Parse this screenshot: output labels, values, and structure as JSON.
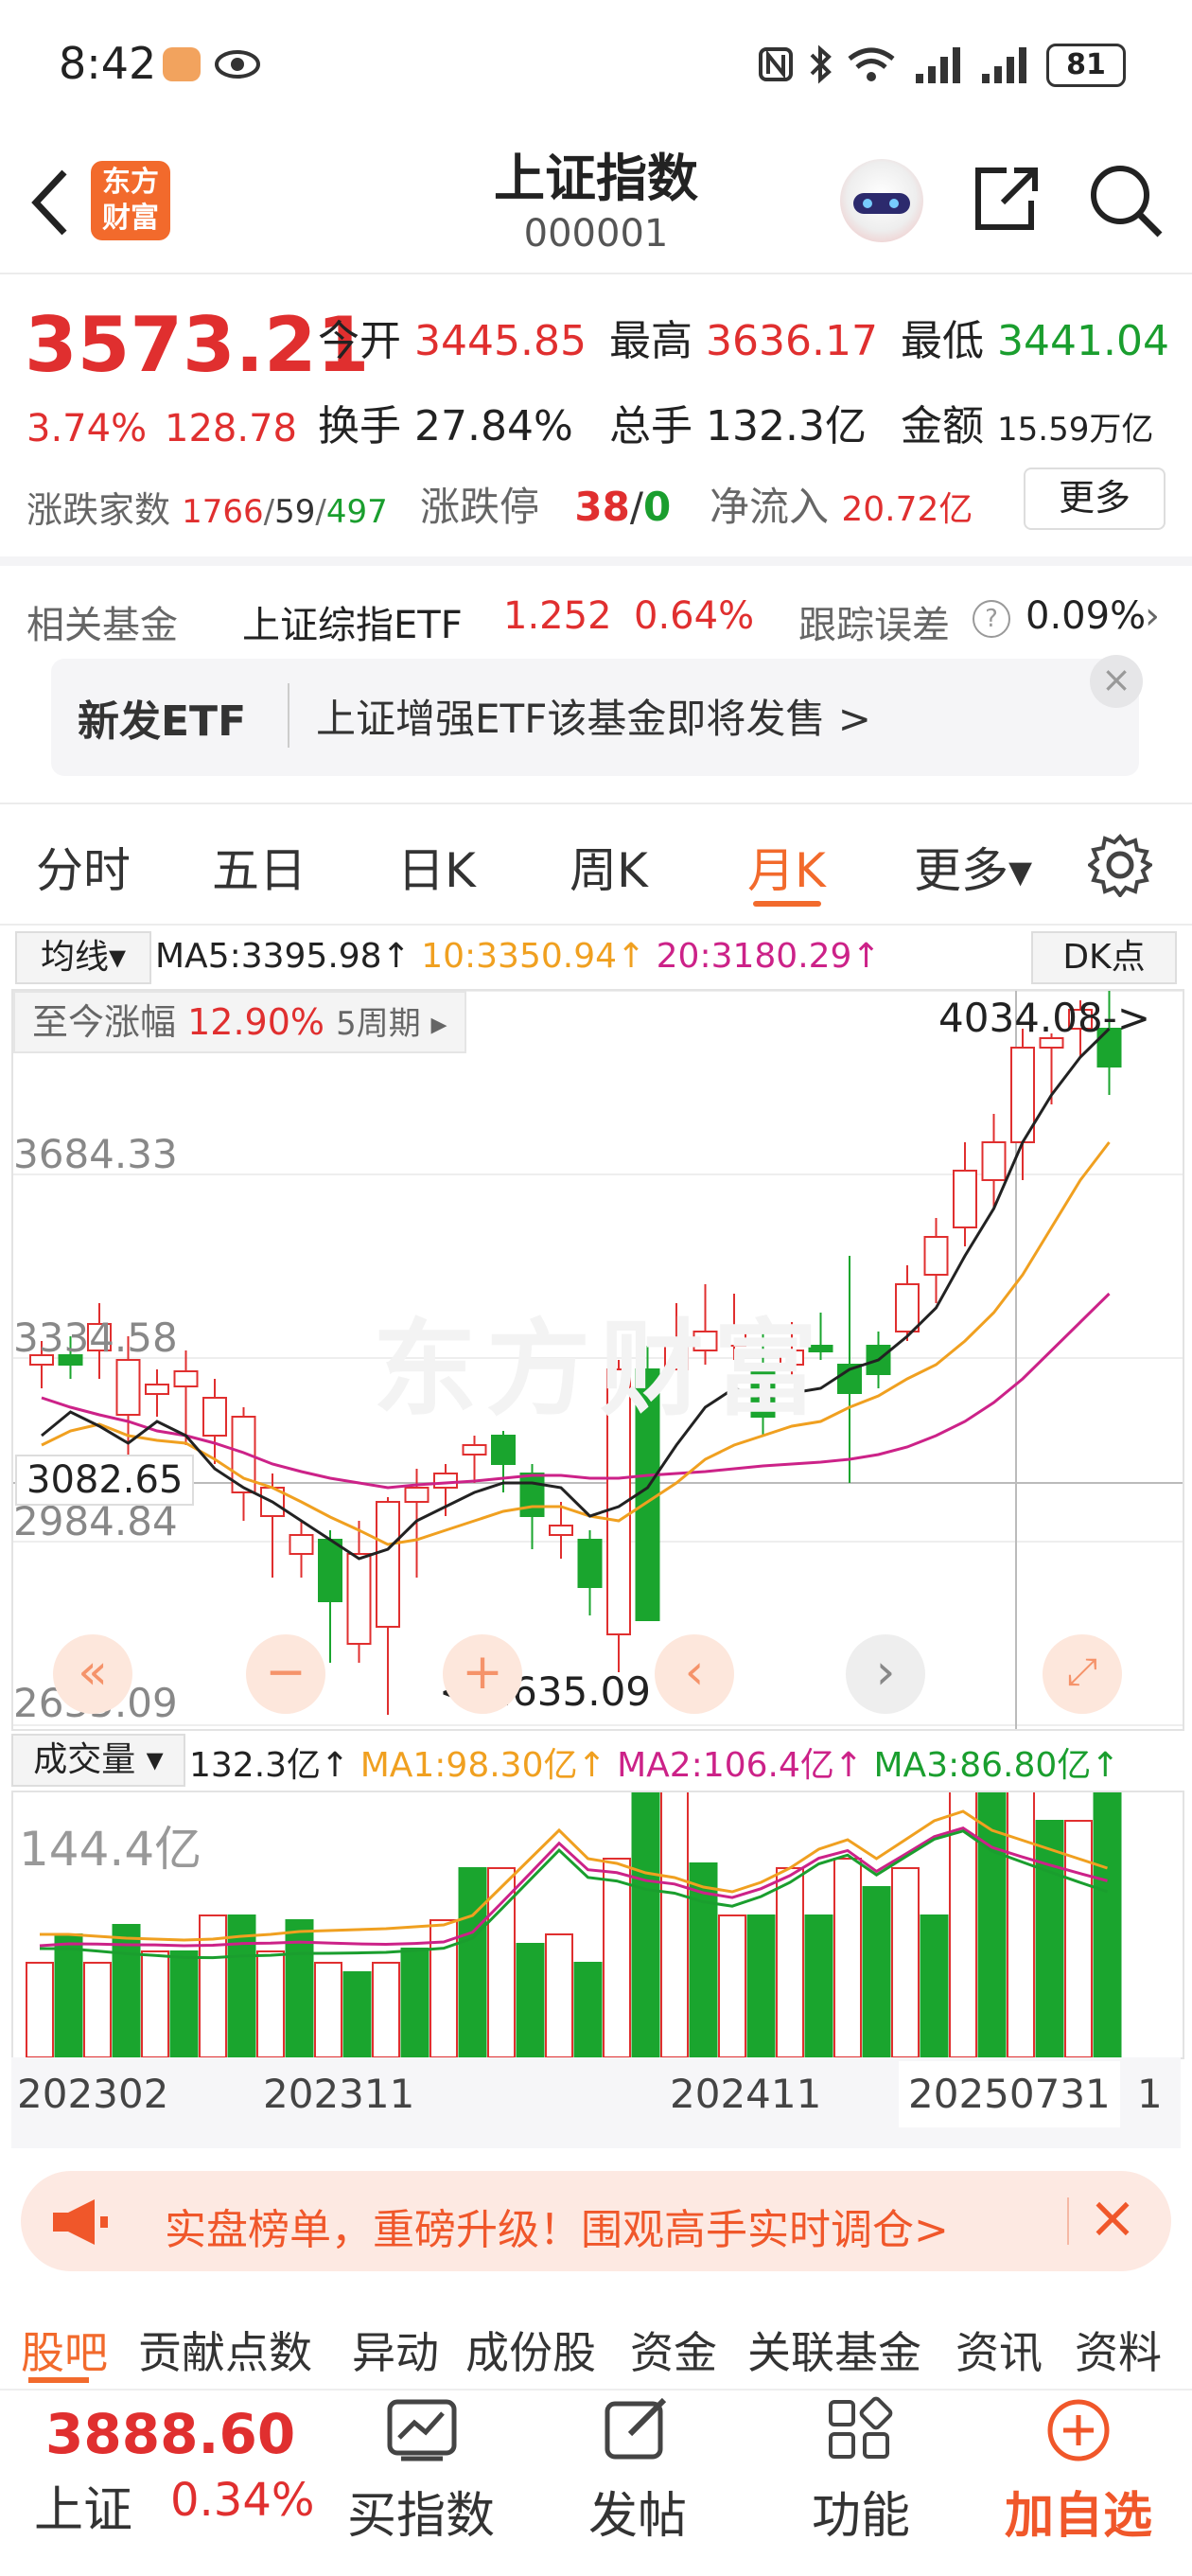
{
  "status_bar": {
    "time": "8:42",
    "battery": "81"
  },
  "header": {
    "logo_line1": "东方",
    "logo_line2": "财富",
    "title": "上证指数",
    "code": "000001"
  },
  "quote": {
    "price": "3573.21",
    "change_pct": "3.74%",
    "change": "128.78",
    "open_label": "今开",
    "open": "3445.85",
    "high_label": "最高",
    "high": "3636.17",
    "low_label": "最低",
    "low": "3441.04",
    "turnover_label": "换手",
    "turnover": "27.84%",
    "volume_label": "总手",
    "volume": "132.3亿",
    "amount_label": "金额",
    "amount": "15.59万亿",
    "breadth_label": "涨跌家数",
    "breadth_up": "1766",
    "breadth_sep1": "/",
    "breadth_flat": "59",
    "breadth_sep2": "/",
    "breadth_down": "497",
    "limit_label": "涨跌停",
    "limit_up": "38",
    "limit_sep": "/",
    "limit_down": "0",
    "inflow_label": "净流入",
    "inflow": "20.72亿",
    "more": "更多"
  },
  "fund": {
    "label": "相关基金",
    "name": "上证综指ETF",
    "price": "1.252",
    "pct": "0.64%",
    "err_label": "跟踪误差",
    "err_value": "0.09%",
    "help": "?"
  },
  "banner": {
    "tag": "新发ETF",
    "text": "上证增强ETF该基金即将发售  >",
    "close": "×"
  },
  "tabs": [
    "分时",
    "五日",
    "日K",
    "周K",
    "月K",
    "更多▾"
  ],
  "ma_bar": {
    "selector": "均线▾",
    "ma5": "MA5:3395.98↑",
    "ma10": "10:3350.94↑",
    "ma20": "20:3180.29↑",
    "dk": "DK点"
  },
  "chart": {
    "since_label": "至今涨幅",
    "since_value": "12.90%",
    "period": "5周期 ▸",
    "y_labels": [
      "3684.33",
      "3334.58",
      "2984.84",
      "2635.09"
    ],
    "crosshair_value": "3082.65",
    "high_mark": "4034.08->",
    "low_mark": "<-2635.09",
    "watermark": "东方财富",
    "colors": {
      "up": "#e02f2f",
      "down": "#1aa52e",
      "ma5": "#222222",
      "ma10": "#f0a020",
      "ma20": "#cc2288"
    }
  },
  "vol_bar": {
    "selector": "成交量 ▾",
    "value": "132.3亿↑",
    "ma1": "MA1:98.30亿↑",
    "ma2": "MA2:106.4亿↑",
    "ma3": "MA3:86.80亿↑",
    "y_label": "144.4亿"
  },
  "x_labels": [
    "202302",
    "202311",
    "202411",
    "20250731",
    "1"
  ],
  "promo": {
    "text": "实盘榜单，重磅升级！围观高手实时调仓>",
    "close": "×"
  },
  "sub_tabs": [
    "股吧",
    "贡献点数",
    "异动",
    "成份股",
    "资金",
    "关联基金",
    "资讯",
    "资料"
  ],
  "bottom": {
    "price": "3888.60",
    "name": "上证",
    "pct": "0.34%",
    "buttons": [
      "买指数",
      "发帖",
      "功能",
      "加自选"
    ]
  }
}
